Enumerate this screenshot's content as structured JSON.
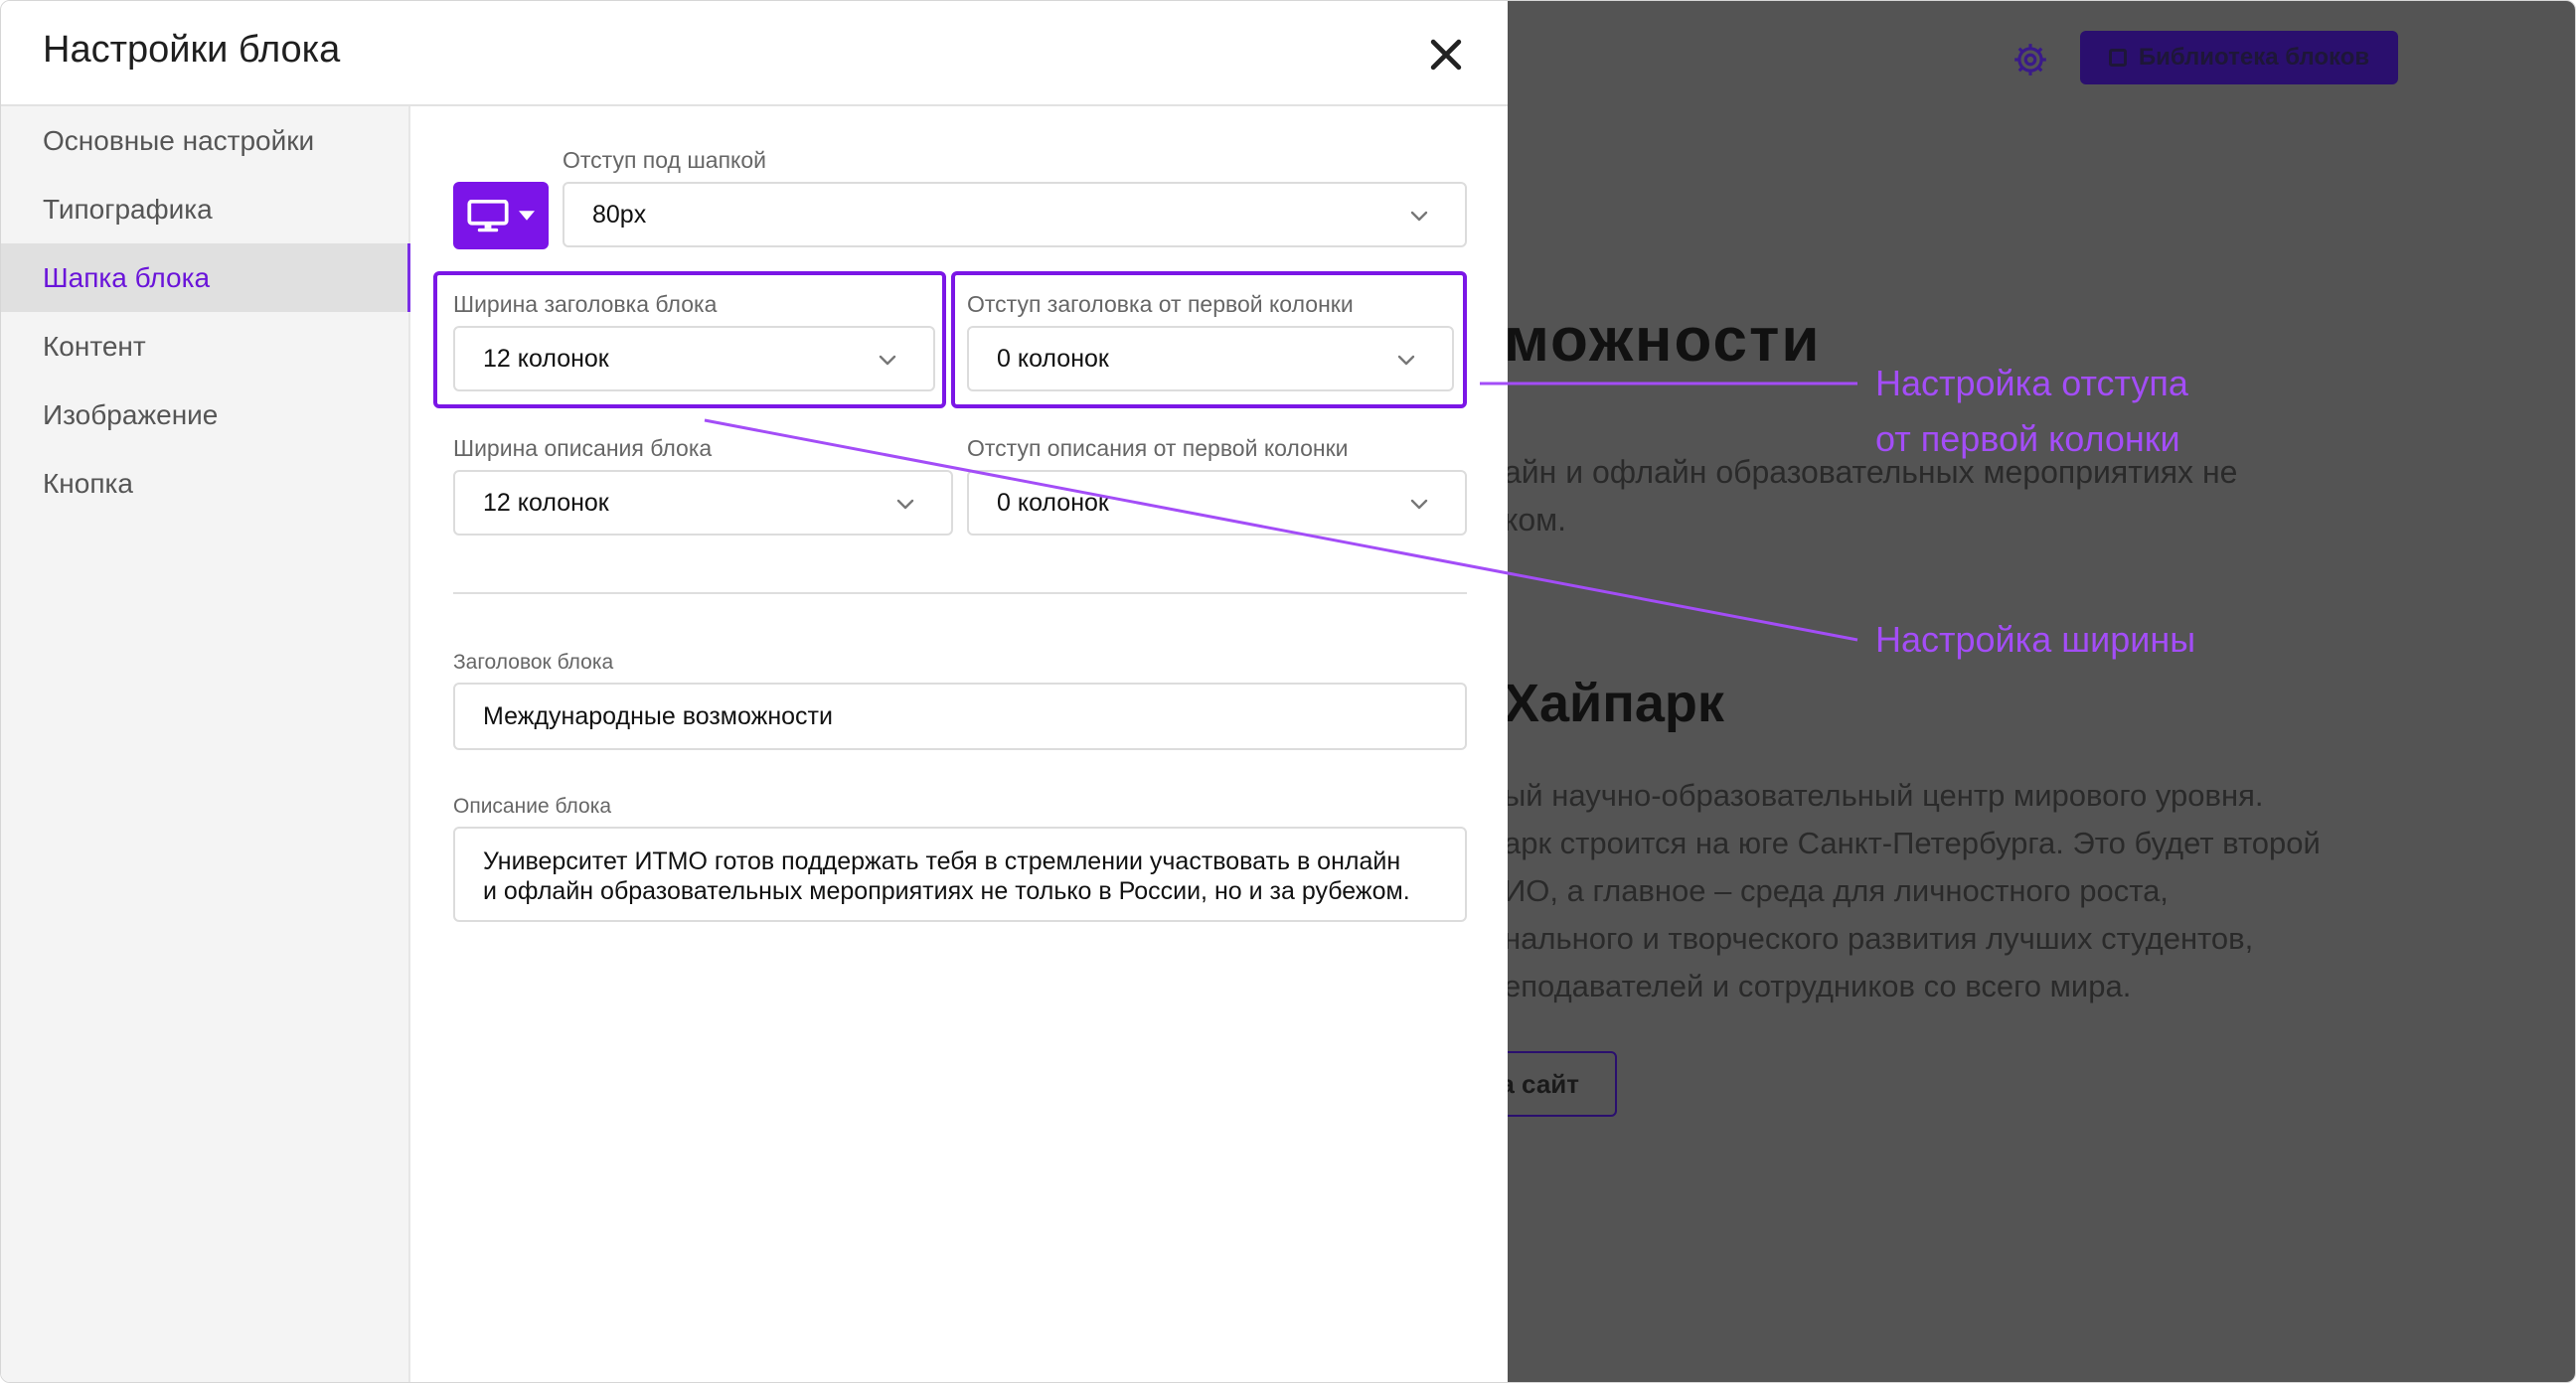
{
  "dialog": {
    "title": "Настройки блока",
    "nav": [
      {
        "label": "Основные настройки",
        "active": false
      },
      {
        "label": "Типографика",
        "active": false
      },
      {
        "label": "Шапка блока",
        "active": true
      },
      {
        "label": "Контент",
        "active": false
      },
      {
        "label": "Изображение",
        "active": false
      },
      {
        "label": "Кнопка",
        "active": false
      }
    ],
    "fields": {
      "header_padding": {
        "label": "Отступ под шапкой",
        "value": "80px"
      },
      "title_width": {
        "label": "Ширина заголовка блока",
        "value": "12 колонок"
      },
      "title_offset": {
        "label": "Отступ заголовка от первой колонки",
        "value": "0 колонок"
      },
      "desc_width": {
        "label": "Ширина описания блока",
        "value": "12 колонок"
      },
      "desc_offset": {
        "label": "Отступ описания от первой колонки",
        "value": "0 колонок"
      },
      "block_title": {
        "label": "Заголовок блока",
        "value": "Международные возможности"
      },
      "block_desc": {
        "label": "Описание блока",
        "line1": "Университет ИТМО готов поддержать тебя в стремлении участвовать в онлайн",
        "line2": "и офлайн образовательных мероприятиях не только в России, но и за рубежом."
      }
    }
  },
  "background_page": {
    "library_button": "Библиотека блоков",
    "heading": "можности",
    "desc_line1": "айн и офлайн образовательных мероприятиях не",
    "desc_line2": "ком.",
    "card_title": "Хайпарк",
    "card_lines": [
      "ый научно-образовательный центр мирового уровня.",
      "арк строится на юге Санкт-Петербурга. Это будет второй",
      "ИО, а главное – среда для личностного роста,",
      "нального и творческого развития лучших студентов,",
      "еподавателей и сотрудников со всего мира."
    ],
    "site_button": "а сайт"
  },
  "annotations": {
    "offset_line1": "Настройка отступа",
    "offset_line2": "от первой колонки",
    "width": "Настройка ширины"
  },
  "colors": {
    "accent": "#7b14e8",
    "annotation": "#a34df7",
    "overlay": "#545454"
  },
  "icons": [
    "settings-gear-icon",
    "library-icon",
    "close-icon",
    "monitor-icon",
    "caret-down-icon",
    "chevron-down-icon"
  ]
}
